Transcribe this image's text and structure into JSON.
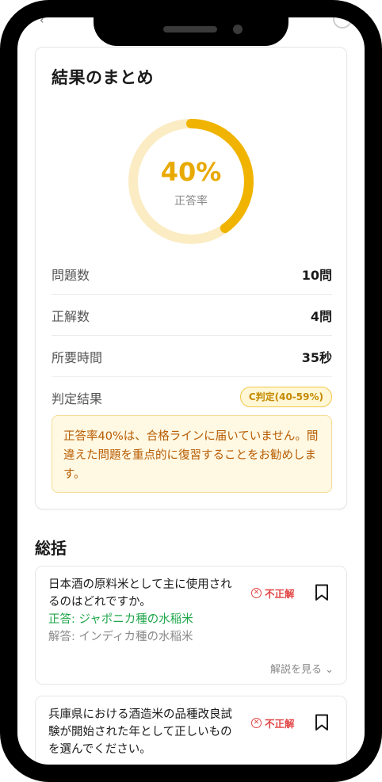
{
  "summary": {
    "title": "結果のまとめ",
    "accuracy_percent": 40,
    "accuracy_text": "40%",
    "accuracy_label": "正答率",
    "stats": [
      {
        "label": "問題数",
        "value": "10問"
      },
      {
        "label": "正解数",
        "value": "4問"
      },
      {
        "label": "所要時間",
        "value": "35秒"
      }
    ],
    "grade_label": "判定結果",
    "grade_value": "C判定(40-59%)",
    "advice": "正答率40%は、合格ラインに届いていません。間違えた問題を重点的に復習することをお勧めします。"
  },
  "review": {
    "title": "総括",
    "questions": [
      {
        "question": "日本酒の原料米として主に使用されるのはどれですか。",
        "correct": "正答: ジャポニカ種の水稲米",
        "answer": "解答: インディカ種の水稲米",
        "status": "不正解",
        "explain": "解説を見る ⌄"
      },
      {
        "question": "兵庫県における酒造米の品種改良試験が開始された年として正しいものを選んでください。",
        "status": "不正解"
      }
    ]
  },
  "colors": {
    "accent": "#f0b400",
    "ring_track": "#fbecc4",
    "correct": "#1fa64a",
    "incorrect": "#e24545"
  },
  "icons": {
    "incorrect": "x-circle-icon",
    "bookmark": "bookmark-icon",
    "expand": "chevron-down-icon"
  }
}
